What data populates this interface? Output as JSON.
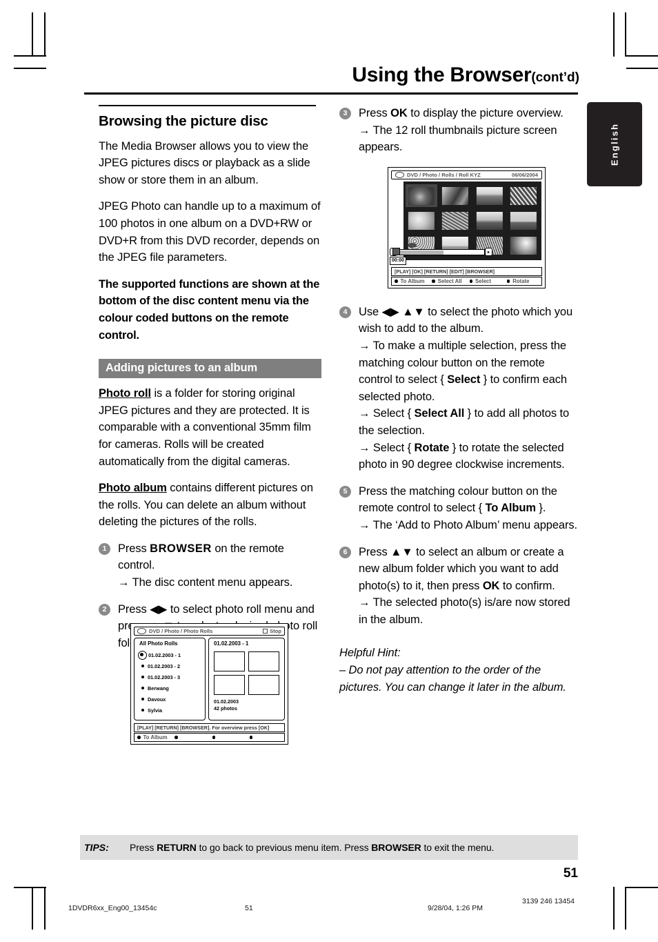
{
  "header": {
    "title": "Using the Browser",
    "contd": "(cont’d)"
  },
  "language_tab": {
    "label": "English"
  },
  "left_column": {
    "section_title": "Browsing the picture disc",
    "paragraphs": [
      "The Media Browser allows you to view the JPEG pictures discs or playback as a slide show or store them in an album.",
      "JPEG Photo can handle up to a maximum of 100 photos in one album on a DVD+RW or DVD+R from this DVD recorder, depends on the JPEG file parameters."
    ],
    "bold_paragraph": "The supported functions are shown at the bottom of the disc content menu via the colour coded buttons on the remote control.",
    "banner": "Adding pictures to an album",
    "photo_roll_term": "Photo roll",
    "photo_roll_text": " is a folder for storing original JPEG pictures and they are protected.  It is comparable with a conventional 35mm film for cameras. Rolls will be created automatically from the digital cameras.",
    "photo_album_term": "Photo album",
    "photo_album_text": " contains different pictures on the rolls. You can delete an album without deleting the pictures of the rolls.",
    "step1": {
      "num": "1",
      "line1_pre": "Press ",
      "line1_key": "BROWSER",
      "line1_post": " on the remote control.",
      "result": "→ The disc content menu appears."
    },
    "step2": {
      "num": "2",
      "text_pre": "Press ",
      "keys1": "◀▶",
      "text_mid": " to select photo roll menu and press ",
      "keys2": "▲ ▼",
      "text_post": " to select a desired photo roll folder."
    }
  },
  "right_column": {
    "step3": {
      "num": "3",
      "pre": "Press ",
      "key": "OK",
      "post": " to display the picture overview.",
      "result": "→ The 12 roll thumbnails picture screen appears."
    },
    "step4": {
      "num": "4",
      "pre": "Use ",
      "keys": "◀▶ ▲▼",
      "post": " to select the photo which you wish to add to the album.",
      "result1_pre": "→ To make a multiple selection, press the matching colour button on the remote control to select { ",
      "result1_key": "Select",
      "result1_post": " } to confirm each selected photo.",
      "result2_pre": "→ Select { ",
      "result2_key": "Select All",
      "result2_post": " } to add all photos to the selection.",
      "result3_pre": "→ Select { ",
      "result3_key": "Rotate",
      "result3_post": " } to rotate the selected photo in 90 degree clockwise increments."
    },
    "step5": {
      "num": "5",
      "pre": "Press the matching colour button on the remote control to select { ",
      "key": "To Album",
      "post": " }.",
      "result": "→ The ‘Add to Photo Album’ menu appears."
    },
    "step6": {
      "num": "6",
      "pre": "Press ",
      "keys": "▲▼",
      "mid": " to select an album or create a new album folder which you want to add photo(s) to it, then press ",
      "key": "OK",
      "post": " to confirm.",
      "result": "→ The selected photo(s) is/are now stored in the album."
    },
    "hint_title": "Helpful Hint:",
    "hint_text": "–  Do not pay attention to the order of the pictures. You can change it later in the album."
  },
  "figure_rolls": {
    "breadcrumb": "DVD / Photo / Photo Rolls",
    "stop_label": "Stop",
    "left_pane_title": "All Photo Rolls",
    "right_pane_title": "01.02.2003 - 1",
    "rolls": [
      {
        "label": "01.02.2003 - 1",
        "selected": true
      },
      {
        "label": "01.02.2003 - 2",
        "selected": false
      },
      {
        "label": "01.02.2003 - 3",
        "selected": false
      },
      {
        "label": "Berwang",
        "selected": false
      },
      {
        "label": "Davoux",
        "selected": false
      },
      {
        "label": "Sylvia",
        "selected": false
      }
    ],
    "meta_date": "01.02.2003",
    "meta_count": "42 photos",
    "help_line": "[PLAY] [RETURN] [BROWSER].  For overview press [OK]",
    "colour_buttons": [
      "To Album",
      "",
      "",
      ""
    ]
  },
  "figure_thumbs": {
    "breadcrumb": "DVD / Photo / Rolls / Roll KYZ",
    "date": "06/06/2004",
    "timecode": "00:00",
    "help_line": "[PLAY] [OK] [RETURN] [EDIT] [BROWSER]",
    "colour_buttons": [
      "To Album",
      "Select All",
      "Select",
      "Rotate"
    ],
    "thumbnails": [
      {
        "style": "ph-a",
        "selected": true
      },
      {
        "style": "ph-b",
        "selected": false
      },
      {
        "style": "ph-c",
        "selected": false
      },
      {
        "style": "ph-d",
        "selected": false
      },
      {
        "style": "ph-e",
        "selected": false
      },
      {
        "style": "ph-f",
        "selected": false
      },
      {
        "style": "ph-g",
        "selected": false
      },
      {
        "style": "ph-h",
        "selected": false
      },
      {
        "style": "ph-i",
        "selected": false
      },
      {
        "style": "ph-j",
        "selected": false
      },
      {
        "style": "ph-k",
        "selected": false
      },
      {
        "style": "ph-l",
        "selected": false
      }
    ]
  },
  "tips": {
    "label": "TIPS:",
    "pre": "Press ",
    "key1": "RETURN",
    "mid": " to go back to previous menu item.  Press ",
    "key2": "BROWSER",
    "post": " to exit the menu."
  },
  "page_number": "51",
  "print_footer": {
    "file": "1DVDR6xx_Eng00_13454c",
    "page": "51",
    "date": "9/28/04, 1:26 PM",
    "code": "3139 246 13454"
  }
}
